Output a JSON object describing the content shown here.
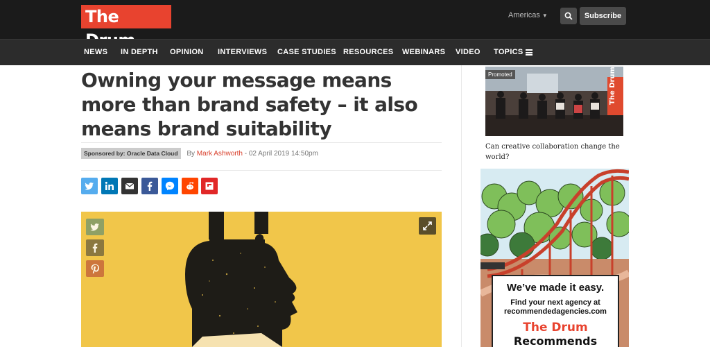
{
  "header": {
    "logo_text": "The Drum",
    "logo_mark": "®",
    "region": "Americas",
    "subscribe_label": "Subscribe"
  },
  "nav": {
    "items": [
      "NEWS",
      "IN DEPTH",
      "OPINION",
      "INTERVIEWS",
      "CASE STUDIES",
      "RESOURCES",
      "WEBINARS",
      "VIDEO",
      "TOPICS"
    ]
  },
  "article": {
    "headline": "Owning your message means more than brand safety – it also means brand suitability",
    "sponsor": "Sponsored by: Oracle Data Cloud",
    "by": "By",
    "author": "Mark Ashworth",
    "date_sep": " - ",
    "date": "02 April 2019 14:50pm"
  },
  "share_buttons": [
    {
      "icon": "twitter-icon",
      "color": "#55acee"
    },
    {
      "icon": "linkedin-icon",
      "color": "#0077b5"
    },
    {
      "icon": "email-icon",
      "color": "#333333"
    },
    {
      "icon": "facebook-icon",
      "color": "#3b5998"
    },
    {
      "icon": "messenger-icon",
      "color": "#0084ff"
    },
    {
      "icon": "reddit-icon",
      "color": "#ff4500"
    },
    {
      "icon": "flipboard-icon",
      "color": "#e12828"
    }
  ],
  "hero_share": [
    {
      "icon": "twitter-icon",
      "color": "#7f9a6a"
    },
    {
      "icon": "facebook-icon",
      "color": "#7a6b3e"
    },
    {
      "icon": "pinterest-icon",
      "color": "#c7693a"
    }
  ],
  "sidebar": {
    "promoted_label": "Promoted",
    "promo_caption": "Can creative collaboration change the world?",
    "promo_banner": "The Drum",
    "ad": {
      "line1": "We’ve made it easy.",
      "line2": "Find your next agency at",
      "line3": "recommendedagencies.com",
      "brand1": "The Drum",
      "brand2": "Recommends"
    }
  },
  "colors": {
    "brand_red": "#e8432f",
    "topbar": "#1b1b1b",
    "navbar": "#2c2c2c",
    "hero_yellow": "#f1c64a"
  }
}
